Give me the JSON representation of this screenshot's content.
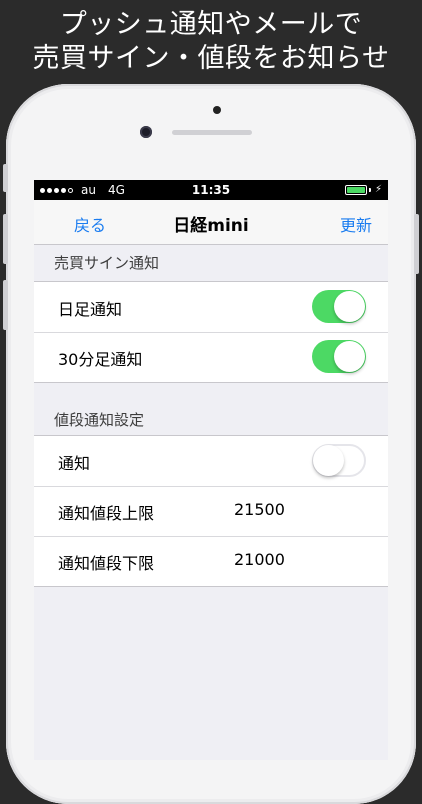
{
  "promo": {
    "line1": "プッシュ通知やメールで",
    "line2": "売買サイン・値段をお知らせ"
  },
  "status_bar": {
    "carrier": "au",
    "network": "4G",
    "time": "11:35",
    "signal_bars_filled": 4,
    "signal_bars_total": 5
  },
  "nav": {
    "back_label": "戻る",
    "title": "日経mini",
    "refresh_label": "更新"
  },
  "sections": {
    "signal": {
      "header": "売買サイン通知",
      "daily_label": "日足通知",
      "daily_on": true,
      "min30_label": "30分足通知",
      "min30_on": true
    },
    "price": {
      "header": "値段通知設定",
      "notify_label": "通知",
      "notify_on": false,
      "upper_label": "通知値段上限",
      "upper_value": "21500",
      "lower_label": "通知値段下限",
      "lower_value": "21000"
    }
  },
  "colors": {
    "accent": "#1a7cf0",
    "toggle_on": "#4cd964",
    "background": "#2b2b2b"
  }
}
